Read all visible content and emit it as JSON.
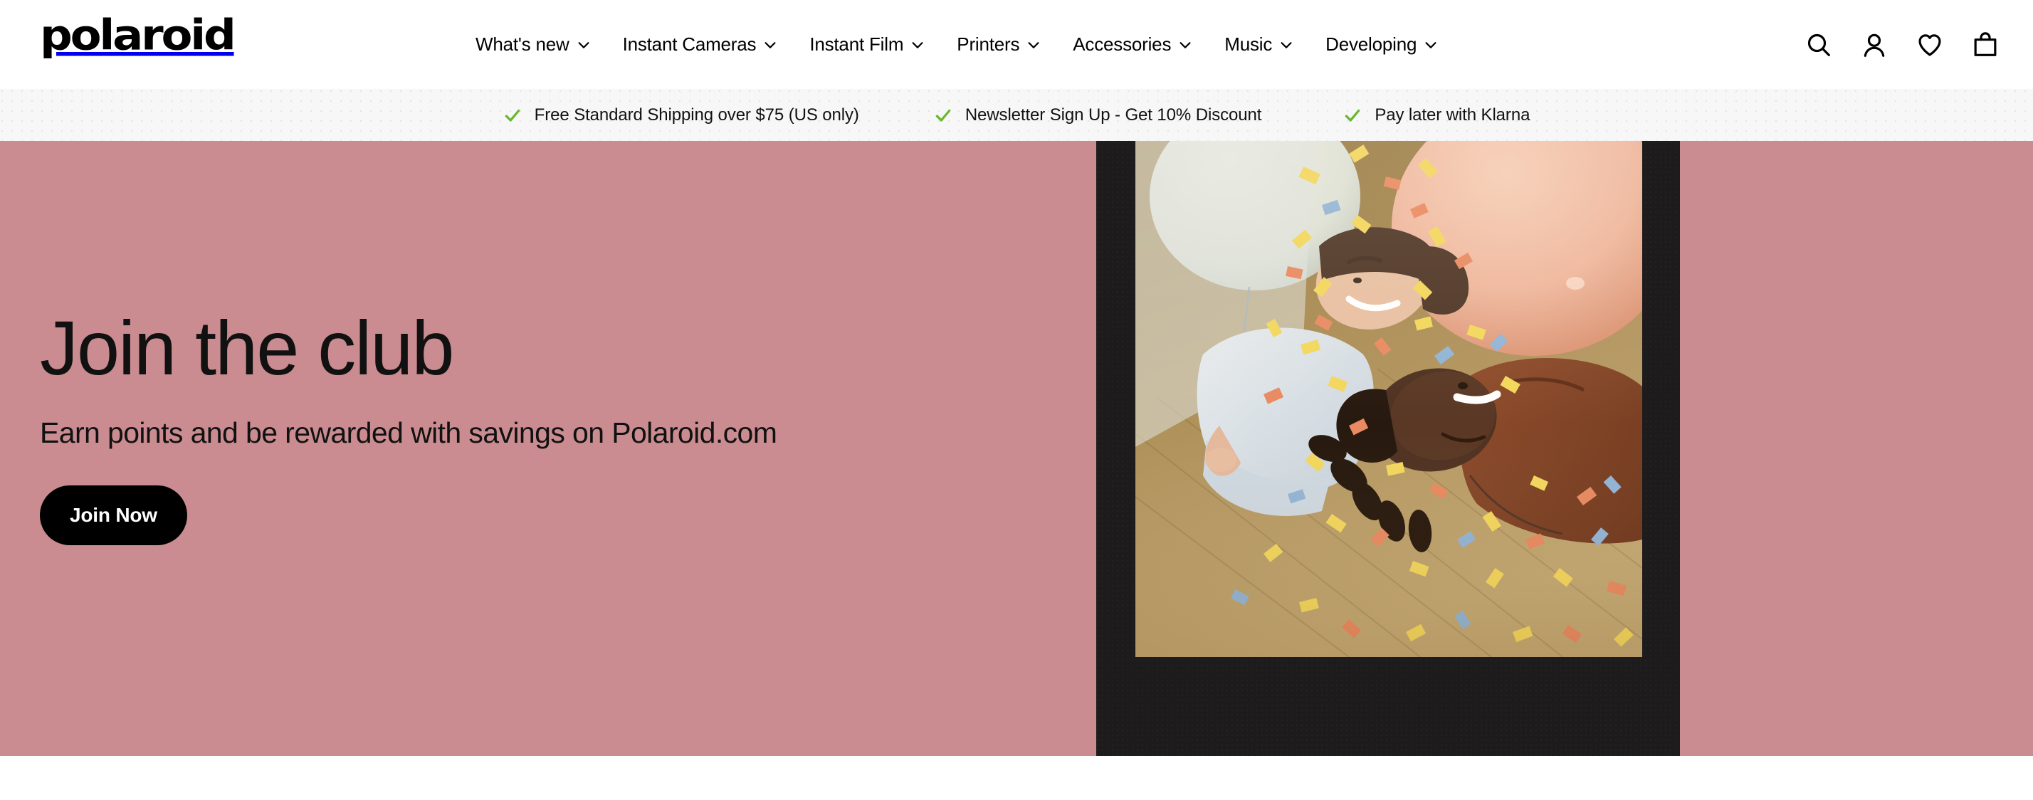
{
  "brand": {
    "logo_text": "polaroid"
  },
  "nav": {
    "items": [
      {
        "label": "What's new",
        "icon": "chevron-down-icon"
      },
      {
        "label": "Instant Cameras",
        "icon": "chevron-down-icon"
      },
      {
        "label": "Instant Film",
        "icon": "chevron-down-icon"
      },
      {
        "label": "Printers",
        "icon": "chevron-down-icon"
      },
      {
        "label": "Accessories",
        "icon": "chevron-down-icon"
      },
      {
        "label": "Music",
        "icon": "chevron-down-icon"
      },
      {
        "label": "Developing",
        "icon": "chevron-down-icon"
      }
    ]
  },
  "header_icons": [
    {
      "name": "search-icon"
    },
    {
      "name": "account-icon"
    },
    {
      "name": "wishlist-heart-icon"
    },
    {
      "name": "shopping-bag-icon"
    }
  ],
  "promo_bar": {
    "check_color": "#6ab82e",
    "items": [
      {
        "icon": "check-icon",
        "text": "Free Standard Shipping over $75 (US only)"
      },
      {
        "icon": "check-icon",
        "text": "Newsletter Sign Up - Get 10% Discount"
      },
      {
        "icon": "check-icon",
        "text": "Pay later with Klarna"
      }
    ]
  },
  "hero": {
    "background_color": "#ca8c90",
    "title": "Join the club",
    "subtitle": "Earn points and be rewarded with savings on Polaroid.com",
    "cta_label": "Join Now",
    "cta_background": "#000000",
    "cta_text_color": "#ffffff",
    "image": {
      "name": "polaroid-photo",
      "frame_color": "#1d1b1c",
      "description": "Two people lying on a wooden floor covered in colorful confetti with balloons"
    }
  }
}
